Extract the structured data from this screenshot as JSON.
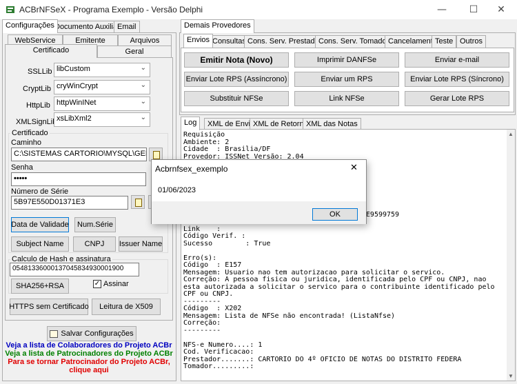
{
  "window": {
    "title": "ACBrNFSeX - Programa Exemplo - Versão Delphi",
    "minimize": "—",
    "maximize": "☐",
    "close": "✕"
  },
  "left": {
    "tabs": [
      "Configurações",
      "Documento Auxiliar",
      "Email"
    ],
    "subtabs_row1": [
      "WebService",
      "Emitente",
      "Arquivos"
    ],
    "subtabs_row2": [
      "Certificado",
      "Geral"
    ],
    "ssllib": {
      "label": "SSLLib",
      "value": "libCustom"
    },
    "cryptlib": {
      "label": "CryptLib",
      "value": "cryWinCrypt"
    },
    "httplib": {
      "label": "HttpLib",
      "value": "httpWinINet"
    },
    "xmlsignlib": {
      "label": "XMLSignLib",
      "value": "xsLibXml2"
    },
    "certificado": {
      "group": "Certificado",
      "caminho_label": "Caminho",
      "caminho_value": "C:\\SISTEMAS CARTORIO\\MYSQL\\GERENCIAD",
      "senha_label": "Senha",
      "senha_value": "•••••",
      "serie_label": "Número de Série",
      "serie_value": "5B97E550D01371E3",
      "btn_validade": "Data de Validade",
      "btn_numserie": "Num.Série",
      "btn_subject": "Subject Name",
      "btn_cnpj": "CNPJ",
      "btn_issuer": "Issuer Name"
    },
    "hash": {
      "group": "Calculo de Hash e assinatura",
      "value": "05481336000137045834930001900",
      "btn_sha": "SHA256+RSA",
      "assinar": "Assinar"
    },
    "btn_https": "HTTPS sem Certificado",
    "btn_x509": "Leitura de X509",
    "btn_salvar": "Salvar Configurações",
    "links": [
      {
        "text": "Veja a lista de Colaboradores do Projeto ACBr",
        "color": "#0000c0"
      },
      {
        "text": "Veja a lista de Patrocinadores do Projeto ACBr",
        "color": "#008000"
      },
      {
        "text": "Para se tornar Patrocinador do Projeto ACBr,",
        "color": "#e00000"
      },
      {
        "text": "clique aqui",
        "color": "#e00000"
      }
    ]
  },
  "right": {
    "tab": "Demais Provedores",
    "subtabs": [
      "Envios",
      "Consultas",
      "Cons. Serv. Prestados",
      "Cons. Serv. Tomados",
      "Cancelamento",
      "Teste",
      "Outros"
    ],
    "buttons": [
      "Emitir Nota (Novo)",
      "Imprimir DANFSe",
      "Enviar e-mail",
      "Enviar Lote RPS (Assíncrono)",
      "Enviar um RPS",
      "Enviar Lote RPS (Síncrono)",
      "Substituir NFSe",
      "Link NFSe",
      "Gerar Lote RPS"
    ],
    "logtabs": [
      "Log",
      "XML de Envio",
      "XML de Retorno",
      "XML das Notas"
    ],
    "log_lines": [
      "Requisição",
      "Ambiente: 2",
      "Cidade  : Brasilia/DF",
      "Provedor: ISSNet Versão: 2.04",
      "",
      "",
      "",
      "",
      "",
      "",
      "",
      "                                            E9599759",
      "",
      "Link    :",
      "Código Verif. :",
      "Sucesso        : True",
      "",
      "Erro(s):",
      "Código  : E157",
      "Mensagem: Usuario nao tem autorizacao para solicitar o servico.",
      "Correção: A pessoa fisica ou juridica, identificada pelo CPF ou CNPJ, nao",
      "esta autorizada a solicitar o servico para o contribuinte identificado pelo",
      "CPF ou CNPJ.",
      "---------",
      "Código  : X202",
      "Mensagem: Lista de NFSe não encontrada! (ListaNfse)",
      "Correção:",
      "---------",
      "",
      "NFS-e Numero....: 1",
      "Cod. Verificacao:",
      "Prestador.......: CARTORIO DO 4º OFICIO DE NOTAS DO DISTRITO FEDERA",
      "Tomador.........:"
    ]
  },
  "dialog": {
    "title": "Acbrnfsex_exemplo",
    "message": "01/06/2023",
    "ok": "OK",
    "close": "✕"
  }
}
